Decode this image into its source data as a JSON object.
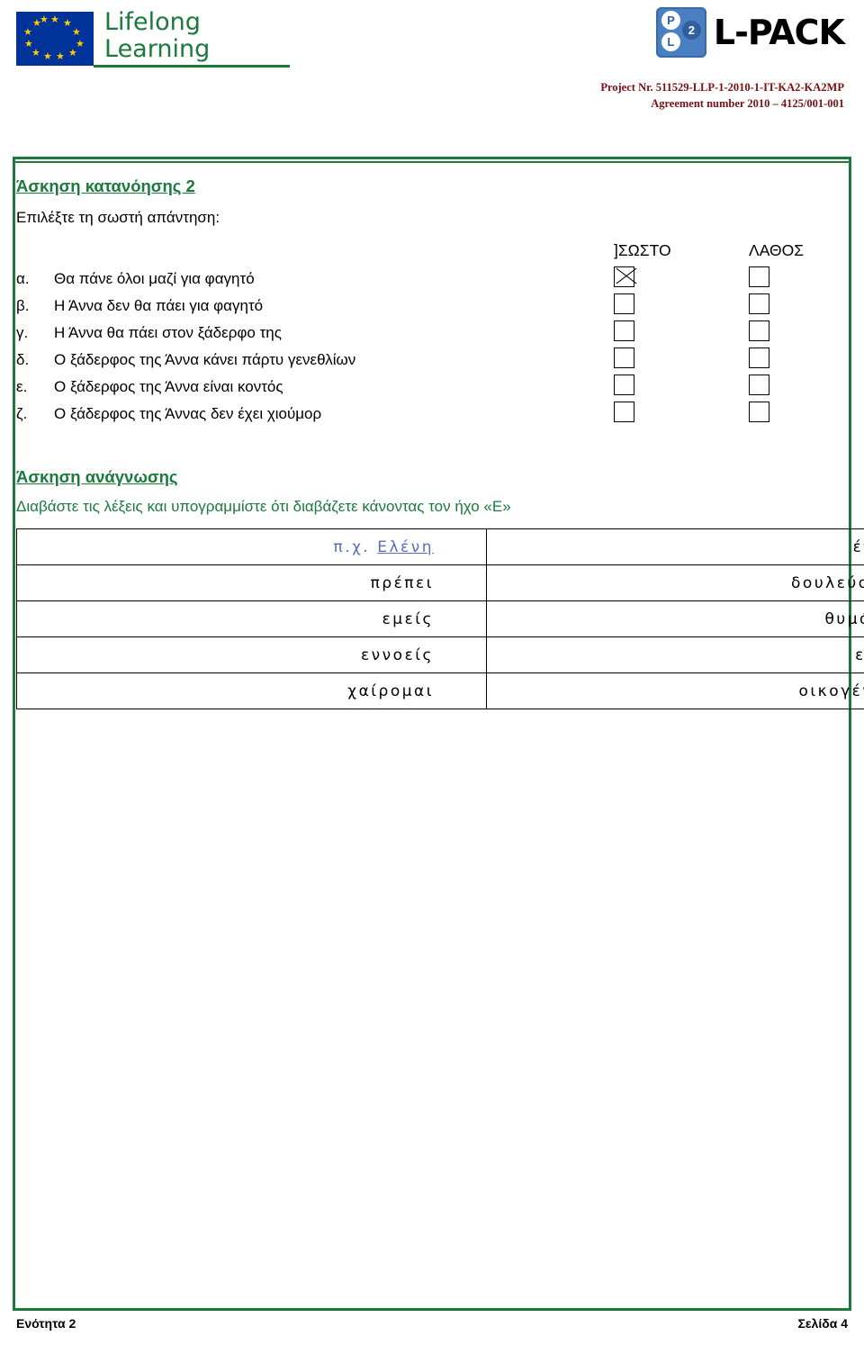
{
  "header": {
    "eu_logo": {
      "line1": "Lifelong",
      "line2": "Learning",
      "icon": "eu-flag-icon"
    },
    "lpack": {
      "wordmark": "L-PACK",
      "badge_letters": [
        "P",
        "2",
        "L"
      ]
    },
    "project_line1": "Project Nr. 511529-LLP-1-2010-1-IT-KA2-KA2MP",
    "project_line2": "Agreement number 2010 – 4125/001-001"
  },
  "exercise": {
    "title": "Άσκηση κατανόησης 2",
    "instruction": "Επιλέξτε τη σωστή απάντηση:",
    "col_right": "]ΣΩΣΤΟ",
    "col_wrong": "ΛΑΘΟΣ",
    "items": [
      {
        "letter": "α.",
        "text": "Θα πάνε όλοι μαζί για φαγητό",
        "right_checked": true,
        "wrong_checked": false
      },
      {
        "letter": "β.",
        "text": "Η Άννα δεν θα πάει για φαγητό",
        "right_checked": false,
        "wrong_checked": false
      },
      {
        "letter": "γ.",
        "text": "Η Άννα θα πάει στον ξάδερφο της",
        "right_checked": false,
        "wrong_checked": false
      },
      {
        "letter": "δ.",
        "text": "Ο ξάδερφος της Άννα κάνει πάρτυ γενεθλίων",
        "right_checked": false,
        "wrong_checked": false
      },
      {
        "letter": "ε.",
        "text": "Ο ξάδερφος της Άννα είναι κοντός",
        "right_checked": false,
        "wrong_checked": false
      },
      {
        "letter": "ζ.",
        "text": "Ο ξάδερφος της Άννας δεν έχει χιούμορ",
        "right_checked": false,
        "wrong_checked": false
      }
    ]
  },
  "reading": {
    "title": "Άσκηση ανάγνωσης",
    "instruction": "Διαβάστε τις λέξεις και υπογραμμίστε ότι διαβάζετε κάνοντας τον ήχο «Ε»",
    "rows": [
      {
        "left_prefix": "π.χ.",
        "left": "Ελένη",
        "left_underline": true,
        "right": "έχεις"
      },
      {
        "left_prefix": "",
        "left": "πρέπει",
        "left_underline": false,
        "right": "δουλεύουμε"
      },
      {
        "left_prefix": "",
        "left": "εμείς",
        "left_underline": false,
        "right": "θυμάσαι"
      },
      {
        "left_prefix": "",
        "left": "εννοείς",
        "left_underline": false,
        "right": "είναι"
      },
      {
        "left_prefix": "",
        "left": "χαίρομαι",
        "left_underline": false,
        "right": "οικογένεια"
      }
    ]
  },
  "footer": {
    "left": "Ενότητα 2",
    "right": "Σελίδα 4"
  },
  "colors": {
    "green": "#1a7a3c",
    "eu_blue": "#003399",
    "star_yellow": "#FFCC00",
    "project_red": "#7b0f14",
    "prefix_blue": "#5a6fb5"
  }
}
